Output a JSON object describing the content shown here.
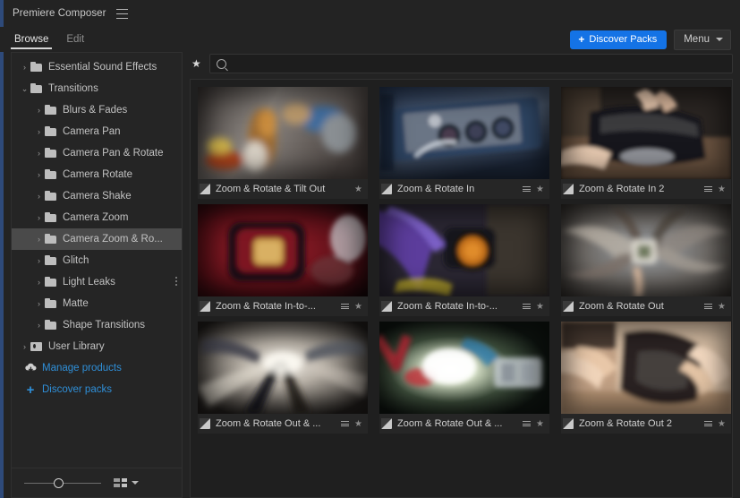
{
  "window": {
    "title": "Premiere Composer",
    "menu_icon": "hamburger-icon"
  },
  "tabs": [
    {
      "label": "Browse",
      "active": true
    },
    {
      "label": "Edit",
      "active": false
    }
  ],
  "toolbar": {
    "discover_packs_label": "Discover Packs",
    "discover_plus": "+",
    "menu_label": "Menu",
    "accent_blue": "#1473e6",
    "link_blue": "#2f8fd8"
  },
  "search": {
    "value": "",
    "placeholder": "",
    "star_glyph": "★",
    "icon": "search-icon"
  },
  "sidebar": {
    "items": [
      {
        "label": "Essential Sound Effects",
        "indent": 0,
        "arrow": "›",
        "selected": false,
        "type": "folder"
      },
      {
        "label": "Transitions",
        "indent": 0,
        "arrow": "⌄",
        "selected": false,
        "type": "folder"
      },
      {
        "label": "Blurs & Fades",
        "indent": 1,
        "arrow": "›",
        "selected": false,
        "type": "folder"
      },
      {
        "label": "Camera Pan",
        "indent": 1,
        "arrow": "›",
        "selected": false,
        "type": "folder"
      },
      {
        "label": "Camera Pan & Rotate",
        "indent": 1,
        "arrow": "›",
        "selected": false,
        "type": "folder"
      },
      {
        "label": "Camera Rotate",
        "indent": 1,
        "arrow": "›",
        "selected": false,
        "type": "folder"
      },
      {
        "label": "Camera Shake",
        "indent": 1,
        "arrow": "›",
        "selected": false,
        "type": "folder"
      },
      {
        "label": "Camera Zoom",
        "indent": 1,
        "arrow": "›",
        "selected": false,
        "type": "folder"
      },
      {
        "label": "Camera Zoom & Ro...",
        "indent": 1,
        "arrow": "›",
        "selected": true,
        "type": "folder"
      },
      {
        "label": "Glitch",
        "indent": 1,
        "arrow": "›",
        "selected": false,
        "type": "folder"
      },
      {
        "label": "Light Leaks",
        "indent": 1,
        "arrow": "›",
        "selected": false,
        "type": "folder",
        "overflow_dots": true
      },
      {
        "label": "Matte",
        "indent": 1,
        "arrow": "›",
        "selected": false,
        "type": "folder"
      },
      {
        "label": "Shape Transitions",
        "indent": 1,
        "arrow": "›",
        "selected": false,
        "type": "folder"
      },
      {
        "label": "User Library",
        "indent": 0,
        "arrow": "›",
        "selected": false,
        "type": "library"
      }
    ],
    "links": [
      {
        "label": "Manage products",
        "icon": "cloud-download-icon"
      },
      {
        "label": "Discover packs",
        "icon": "plus-icon"
      }
    ]
  },
  "statusbar": {
    "zoom_slider_value": 38,
    "view_toggle_icon": "grid-view-icon",
    "view_caret": "⌄"
  },
  "grid": {
    "cards": [
      {
        "label": "Zoom & Rotate & Tilt Out",
        "has_menu": false,
        "starred": false,
        "art": "motion-blur-warm"
      },
      {
        "label": "Zoom & Rotate In",
        "has_menu": true,
        "starred": false,
        "art": "blue-audio-gear"
      },
      {
        "label": "Zoom & Rotate In 2",
        "has_menu": true,
        "starred": false,
        "art": "hands-dark-bag"
      },
      {
        "label": "Zoom & Rotate In-to-...",
        "has_menu": true,
        "starred": false,
        "art": "red-gold-closeup"
      },
      {
        "label": "Zoom & Rotate In-to-...",
        "has_menu": true,
        "starred": false,
        "art": "purple-orange-hub"
      },
      {
        "label": "Zoom & Rotate Out",
        "has_menu": true,
        "starred": false,
        "art": "swirl-radial-blur"
      },
      {
        "label": "Zoom & Rotate Out & ...",
        "has_menu": true,
        "starred": false,
        "art": "zoom-blur-street"
      },
      {
        "label": "Zoom & Rotate Out & ...",
        "has_menu": true,
        "starred": false,
        "art": "green-light-flare"
      },
      {
        "label": "Zoom & Rotate Out 2",
        "has_menu": true,
        "starred": false,
        "art": "hands-fabric"
      }
    ],
    "card_menu_icon": "list-menu-icon",
    "card_star_icon": "star-icon",
    "card_type_icon": "transition-icon"
  }
}
